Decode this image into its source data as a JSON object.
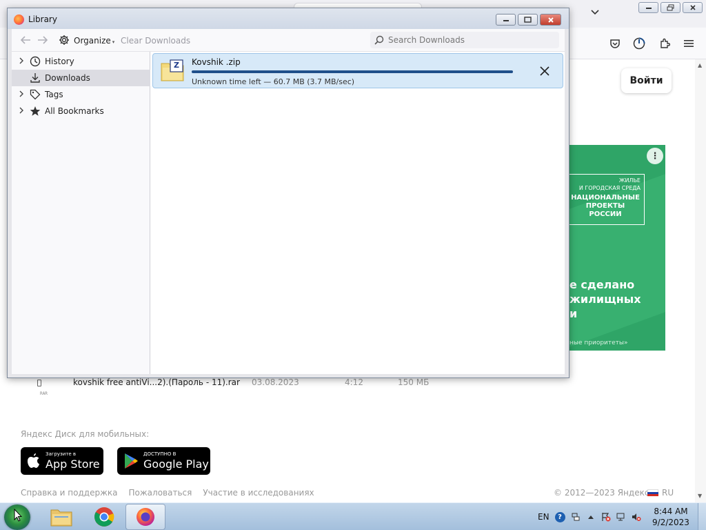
{
  "background_page": {
    "login_button": "Войти",
    "ad": {
      "menu": "⋮",
      "tag_line1": "ЖИЛЬЕ",
      "tag_line2": "И ГОРОДСКАЯ СРЕДА",
      "natproj": "НАЦИОНАЛЬНЫЕ ПРОЕКТЫ РОССИИ",
      "headline": "е сделано\nжилищных\nи",
      "footer": "ные приоритеты»",
      "bg_color": "#2fa567"
    },
    "file_row": {
      "icon_label": "RAR",
      "name": "kovshik free antiVi...2).(Пароль - 11).rar",
      "date": "03.08.2023",
      "time": "4:12",
      "size": "150 МБ"
    },
    "mobile_label": "Яндекс Диск для мобильных:",
    "app_store": {
      "small": "Загрузите в",
      "big": "App Store"
    },
    "google_play": {
      "small": "ДОСТУПНО В",
      "big": "Google Play"
    },
    "footer_links": [
      "Справка и поддержка",
      "Пожаловаться",
      "Участие в исследованиях"
    ],
    "copyright": "© 2012—2023 Яндекс",
    "language": "RU"
  },
  "library": {
    "title": "Library",
    "toolbar": {
      "organize": "Organize",
      "clear_downloads": "Clear Downloads",
      "search_placeholder": "Search Downloads"
    },
    "sidebar": {
      "items": [
        {
          "label": "History",
          "icon": "clock-icon",
          "expandable": true
        },
        {
          "label": "Downloads",
          "icon": "download-icon",
          "expandable": false,
          "selected": true
        },
        {
          "label": "Tags",
          "icon": "tag-icon",
          "expandable": true
        },
        {
          "label": "All Bookmarks",
          "icon": "star-icon",
          "expandable": true
        }
      ]
    },
    "download": {
      "filename": "Kovshik .zip",
      "status": "Unknown time left — 60.7 MB (3.7 MB/sec)",
      "progress": 1.0,
      "icon_letter": "Z"
    }
  },
  "taskbar": {
    "language": "EN",
    "time": "8:44 AM",
    "date": "9/2/2023",
    "apps": [
      "file-explorer",
      "chrome",
      "firefox"
    ]
  }
}
